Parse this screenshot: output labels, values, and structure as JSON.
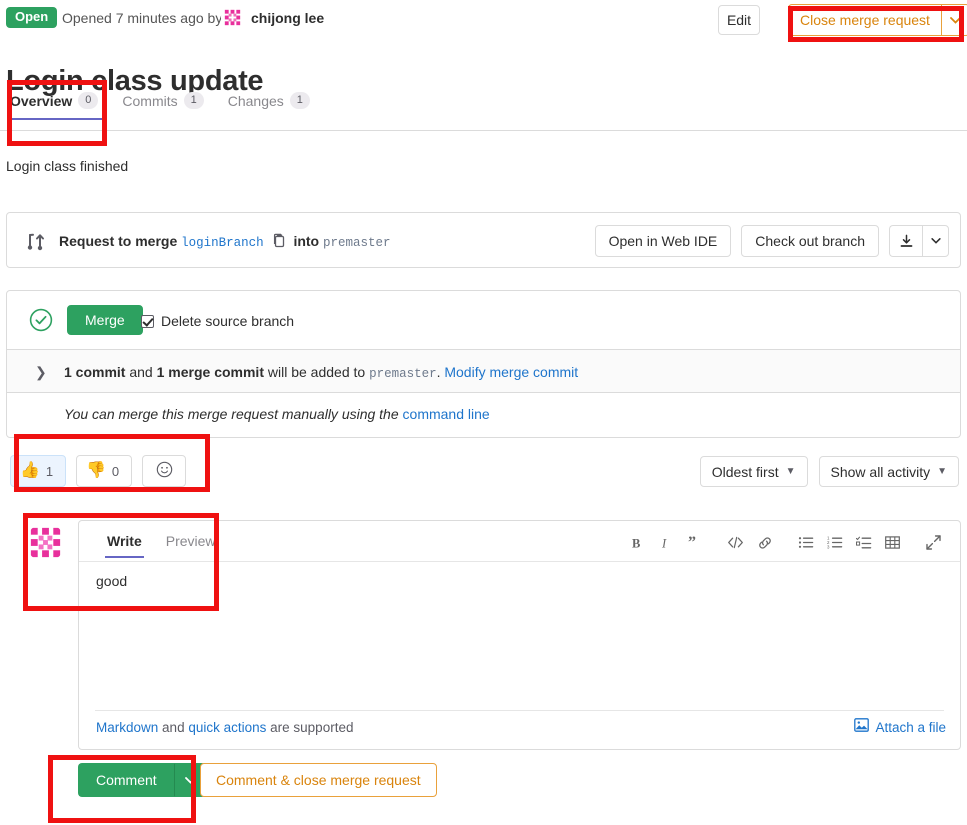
{
  "header": {
    "status_label": "Open",
    "opened_text": "Opened 7 minutes ago by",
    "author": "chijong lee",
    "edit_label": "Edit",
    "close_mr_label": "Close merge request"
  },
  "title": "Login class update",
  "tabs": [
    {
      "label": "Overview",
      "badge": "0",
      "active": true
    },
    {
      "label": "Commits",
      "badge": "1",
      "active": false
    },
    {
      "label": "Changes",
      "badge": "1",
      "active": false
    }
  ],
  "description": "Login class finished",
  "branch_card": {
    "prefix": "Request to merge",
    "source_branch": "loginBranch",
    "into": "into",
    "target_branch": "premaster",
    "open_web_ide_label": "Open in Web IDE",
    "check_out_branch_label": "Check out branch"
  },
  "merge_card": {
    "merge_label": "Merge",
    "delete_source_branch_label": "Delete source branch",
    "commit_count": "1 commit",
    "and": "and",
    "merge_commit_count": "1 merge commit",
    "will_be_added": "will be added to",
    "target_branch": "premaster",
    "period": ".",
    "modify_merge_commit_label": "Modify merge commit",
    "manual_text": "You can merge this merge request manually using the",
    "command_line_label": "command line"
  },
  "awards": {
    "thumbsup_count": "1",
    "thumbsdown_count": "0"
  },
  "sorters": {
    "sort_label": "Oldest first",
    "filter_label": "Show all activity"
  },
  "comment_form": {
    "write_tab": "Write",
    "preview_tab": "Preview",
    "body_text": "good",
    "markdown_label": "Markdown",
    "and_text": "and",
    "quick_actions_label": "quick actions",
    "supported_text": "are supported",
    "attach_label": "Attach a file",
    "comment_label": "Comment",
    "comment_close_label": "Comment & close merge request"
  },
  "colors": {
    "green": "#2da160",
    "orange": "#d9840d",
    "link_blue": "#1f75cb",
    "active_tab_underline": "#6666c4",
    "annotation_red": "#ef1111",
    "avatar_pink": "#e8309c"
  }
}
